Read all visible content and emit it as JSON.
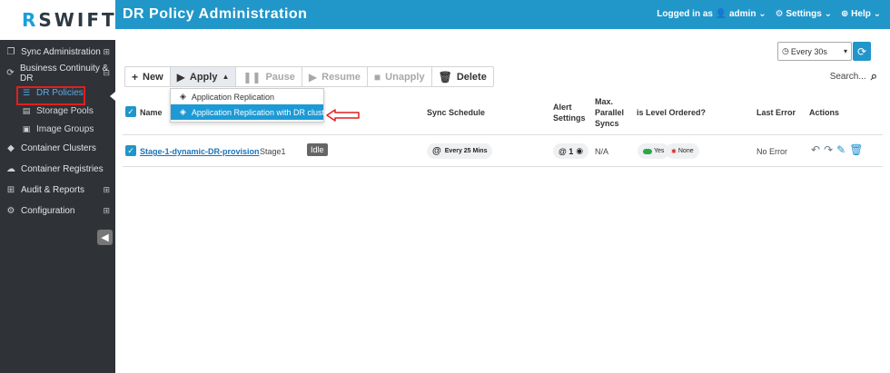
{
  "app": {
    "logo_mark": "R",
    "logo_text": "SWIFT"
  },
  "header": {
    "title": "DR Policy Administration",
    "logged_in_label": "Logged in as",
    "user": "admin",
    "settings": "Settings",
    "help": "Help"
  },
  "sidebar": {
    "items": [
      {
        "label": "Sync Administration",
        "icon": "copy-icon",
        "expand": "⊞"
      },
      {
        "label": "Business Continuity & DR",
        "icon": "sync-icon",
        "expand": "⊟"
      },
      {
        "label": "Container Clusters",
        "icon": "cube-icon"
      },
      {
        "label": "Container Registries",
        "icon": "cloud-icon"
      },
      {
        "label": "Audit & Reports",
        "icon": "grid-icon",
        "expand": "⊞"
      },
      {
        "label": "Configuration",
        "icon": "cogs-icon",
        "expand": "⊞"
      }
    ],
    "subitems": [
      {
        "label": "DR Policies",
        "icon": "list-icon",
        "active": true
      },
      {
        "label": "Storage Pools",
        "icon": "database-icon"
      },
      {
        "label": "Image Groups",
        "icon": "image-icon"
      }
    ]
  },
  "refresh": {
    "selected": "Every 30s"
  },
  "toolbar": {
    "new": "New",
    "apply": "Apply",
    "pause": "Pause",
    "resume": "Resume",
    "unapply": "Unapply",
    "delete": "Delete"
  },
  "search": {
    "label": "Search..."
  },
  "apply_menu": {
    "items": [
      "Application Replication",
      "Application Replication with DR cluster"
    ],
    "highlighted_index": 1
  },
  "table": {
    "headers": {
      "name": "Name",
      "sync_schedule": "Sync Schedule",
      "alert_settings": [
        "Alert",
        "Settings"
      ],
      "max_parallel": [
        "Max.",
        "Parallel",
        "Syncs"
      ],
      "level_ordered": "is Level Ordered?",
      "last_error": "Last Error",
      "actions": "Actions"
    },
    "rows": [
      {
        "name": "Stage-1-dynamic-DR-provision",
        "stage": "Stage1",
        "status": "Idle",
        "sync_schedule": "Every 25 Mins",
        "alert": "@ 1",
        "max_parallel": "N/A",
        "level_ordered_yes": "Yes",
        "level_ordered_none": "None",
        "last_error": "No Error"
      }
    ]
  },
  "colors": {
    "accent": "#2196c9",
    "sidebar": "#2f3338",
    "highlight": "#1d9ad6",
    "annotation": "#e01f1f"
  }
}
